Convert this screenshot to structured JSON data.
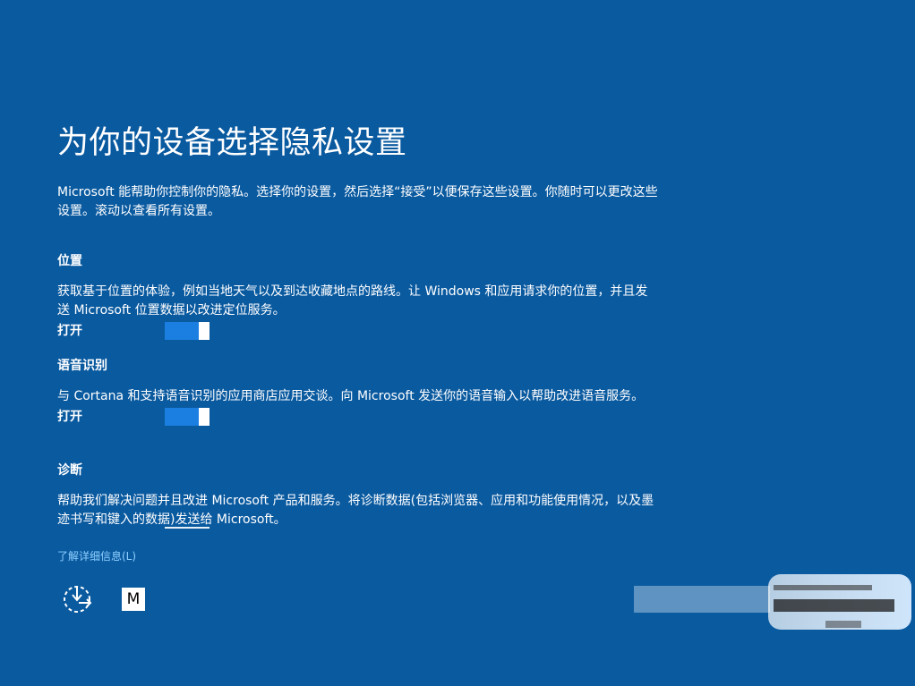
{
  "page": {
    "title": "为你的设备选择隐私设置",
    "intro": "Microsoft 能帮助你控制你的隐私。选择你的设置，然后选择“接受”以便保存这些设置。你随时可以更改这些设置。滚动以查看所有设置。"
  },
  "sections": [
    {
      "heading": "位置",
      "description": "获取基于位置的体验，例如当地天气以及到达收藏地点的路线。让 Windows 和应用请求你的位置，并且发送 Microsoft 位置数据以改进定位服务。",
      "toggle_label": "打开",
      "toggle_state": "on"
    },
    {
      "heading": "语音识别",
      "description": "与 Cortana 和支持语音识别的应用商店应用交谈。向 Microsoft 发送你的语音输入以帮助改进语音服务。",
      "toggle_label": "打开",
      "toggle_state": "on"
    },
    {
      "heading": "诊断",
      "description": "帮助我们解决问题并且改进 Microsoft 产品和服务。将诊断数据(包括浏览器、应用和功能使用情况，以及墨迹书写和键入的数据)发送给 Microsoft。"
    }
  ],
  "footer": {
    "learn_more": "了解详细信息(L)",
    "ease_of_access_icon": "ease-of-access-icon",
    "ime_label": "M"
  },
  "colors": {
    "background": "#0a5aa0",
    "toggle_on": "#1a7fe0",
    "link": "#8fd0ff"
  }
}
